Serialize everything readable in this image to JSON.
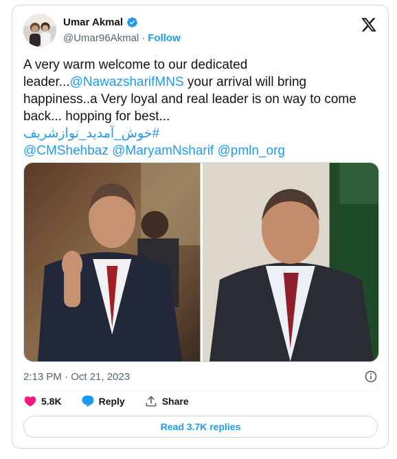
{
  "user": {
    "name": "Umar Akmal",
    "handle": "@Umar96Akmal",
    "separator": "·",
    "follow_label": "Follow"
  },
  "tweet": {
    "text_part1": "A very warm welcome to our dedicated leader...",
    "mention_nawaz": "@NawazsharifMNS",
    "text_part2": " your arrival will bring happiness..a Very loyal and real leader is on way to come back... hopping for best...",
    "hashtag": "#خوش_آمدید_نوازشریف",
    "mention_shehbaz": "@CMShehbaz",
    "mention_maryam": "@MaryamNsharif",
    "mention_pmln": "@pmln_org"
  },
  "meta": {
    "timestamp": "2:13 PM · Oct 21, 2023"
  },
  "actions": {
    "likes_count": "5.8K",
    "reply_label": "Reply",
    "share_label": "Share"
  },
  "read_replies_label": "Read 3.7K replies",
  "colors": {
    "link": "#1d9bf0",
    "like": "#f91880",
    "text": "#0f1419",
    "muted": "#536471",
    "border": "#cfd9de"
  },
  "icons": {
    "verified": "verified-badge-icon",
    "x_logo": "x-logo-icon",
    "info": "info-icon",
    "like": "heart-icon",
    "reply": "reply-bubble-icon",
    "share": "share-upload-icon"
  }
}
